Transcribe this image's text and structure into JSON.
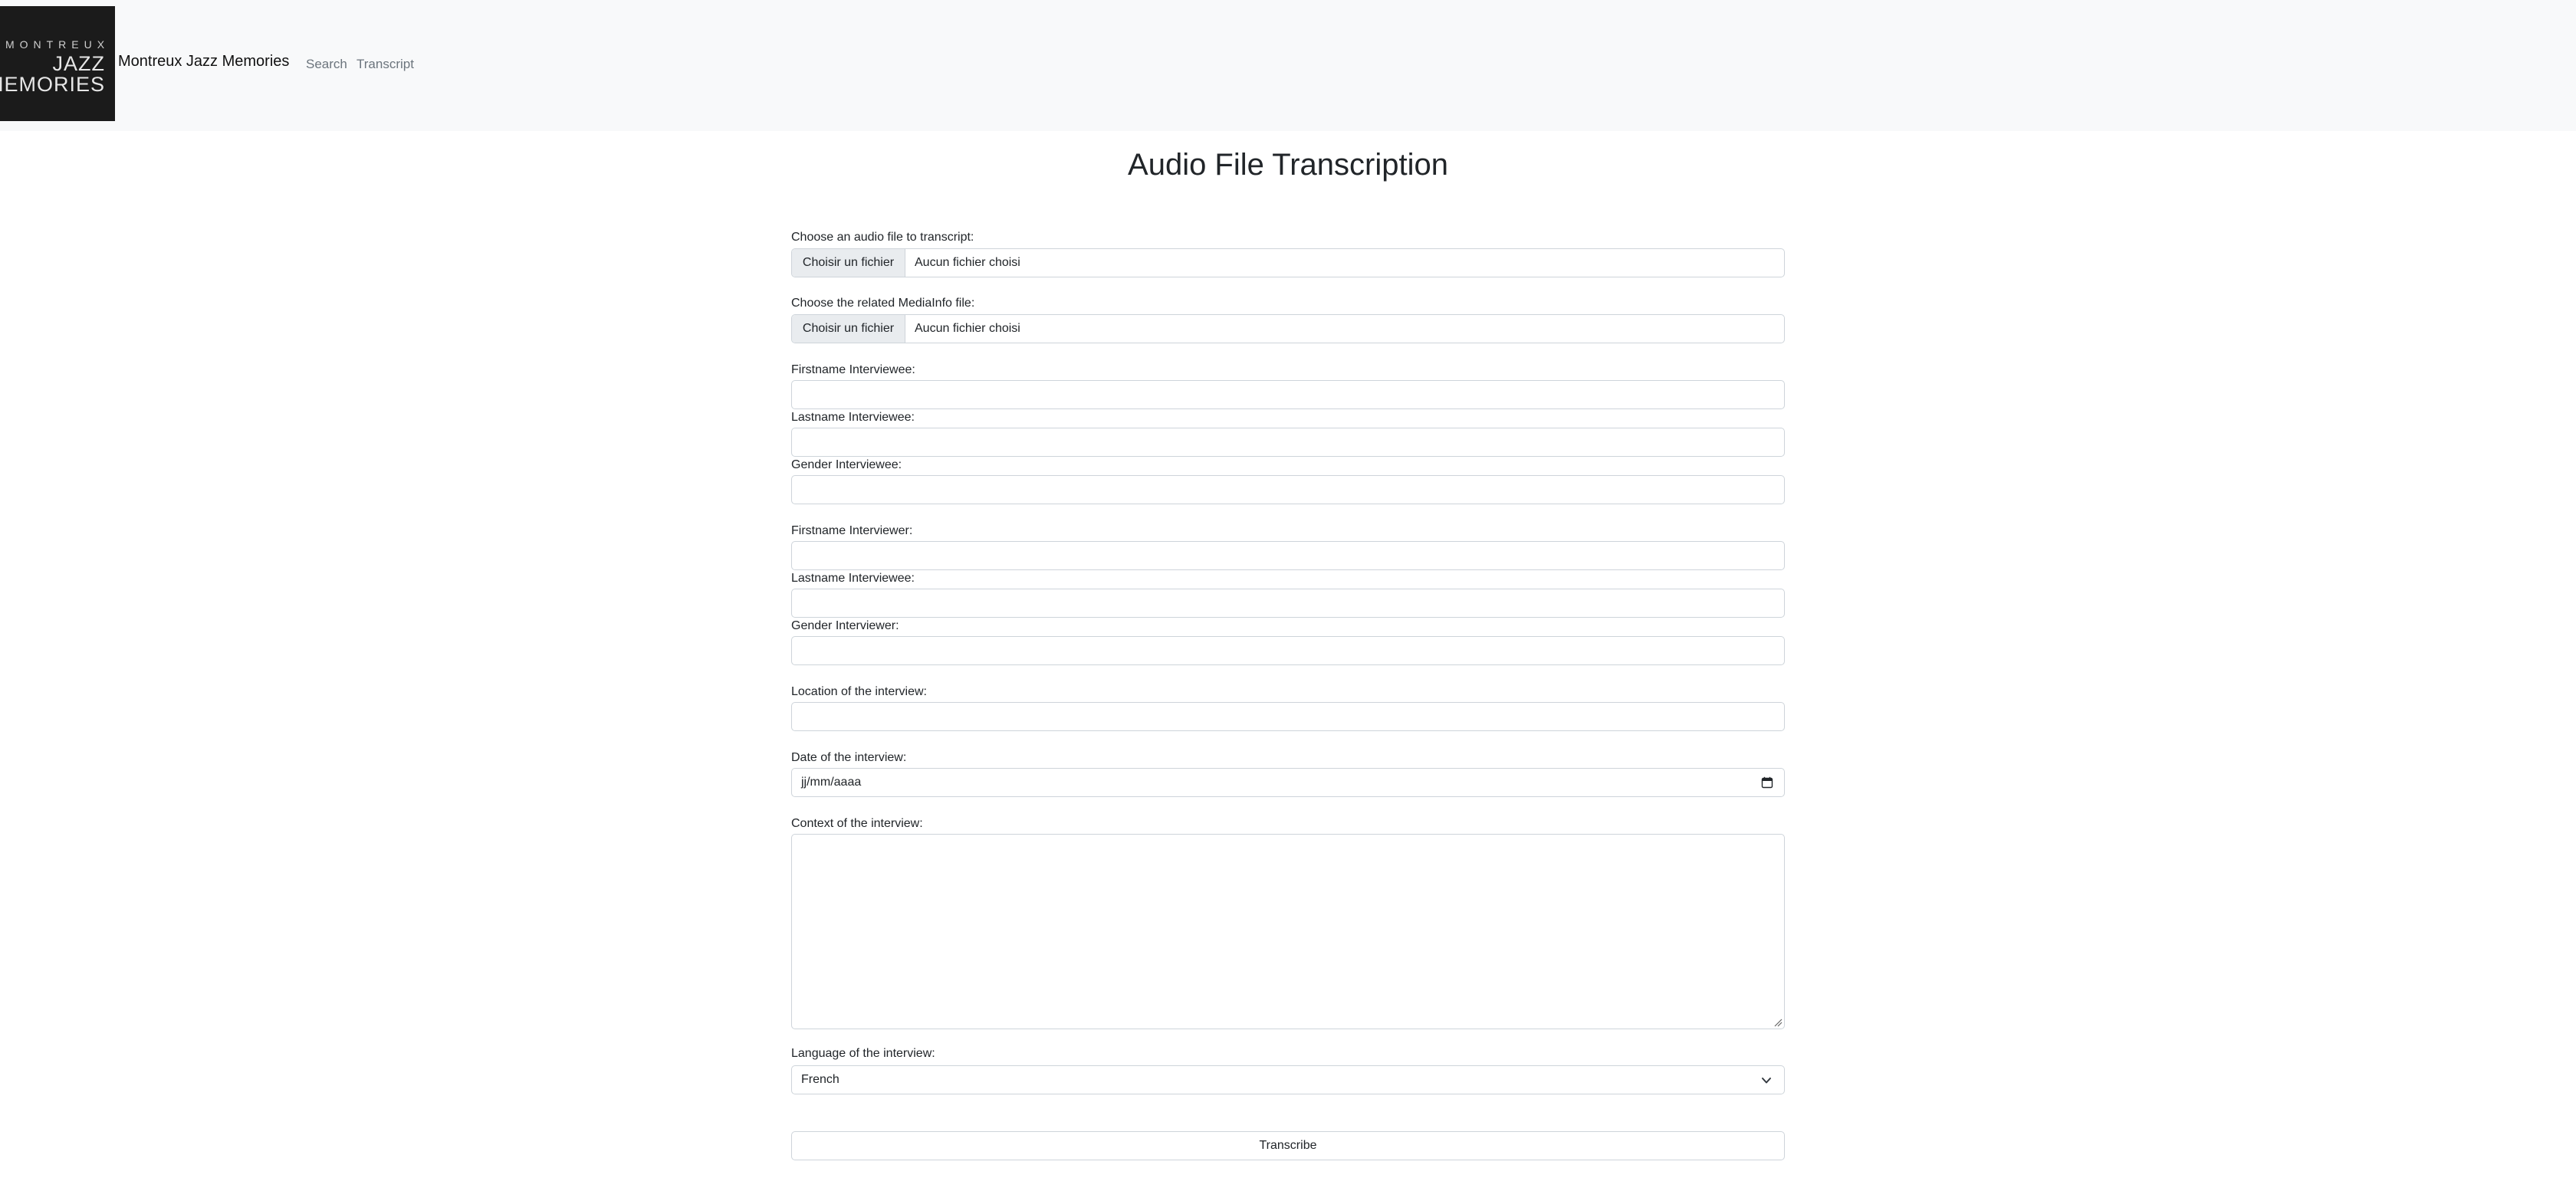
{
  "navbar": {
    "logo": {
      "line1": "MONTREUX",
      "line2": "JAZZ",
      "line3": "MEMORIES"
    },
    "brand": "Montreux Jazz Memories",
    "links": [
      "Search",
      "Transcript"
    ]
  },
  "page": {
    "title": "Audio File Transcription"
  },
  "form": {
    "audio_file": {
      "label": "Choose an audio file to transcript:",
      "button": "Choisir un fichier",
      "status": "Aucun fichier choisi"
    },
    "mediainfo_file": {
      "label": "Choose the related MediaInfo file:",
      "button": "Choisir un fichier",
      "status": "Aucun fichier choisi"
    },
    "firstname_interviewee": {
      "label": "Firstname Interviewee:",
      "value": ""
    },
    "lastname_interviewee": {
      "label": "Lastname Interviewee:",
      "value": ""
    },
    "gender_interviewee": {
      "label": "Gender Interviewee:",
      "value": ""
    },
    "firstname_interviewer": {
      "label": "Firstname Interviewer:",
      "value": ""
    },
    "lastname_interviewer": {
      "label": "Lastname Interviewee:",
      "value": ""
    },
    "gender_interviewer": {
      "label": "Gender Interviewer:",
      "value": ""
    },
    "location": {
      "label": "Location of the interview:",
      "value": ""
    },
    "date": {
      "label": "Date of the interview:",
      "placeholder": "jj/mm/aaaa"
    },
    "context": {
      "label": "Context of the interview:",
      "value": ""
    },
    "language": {
      "label": "Language of the interview:",
      "selected": "French"
    },
    "submit": "Transcribe"
  },
  "icons": {
    "calendar": "calendar-icon",
    "chevron": "chevron-down-icon",
    "resize": "resize-handle-icon"
  }
}
